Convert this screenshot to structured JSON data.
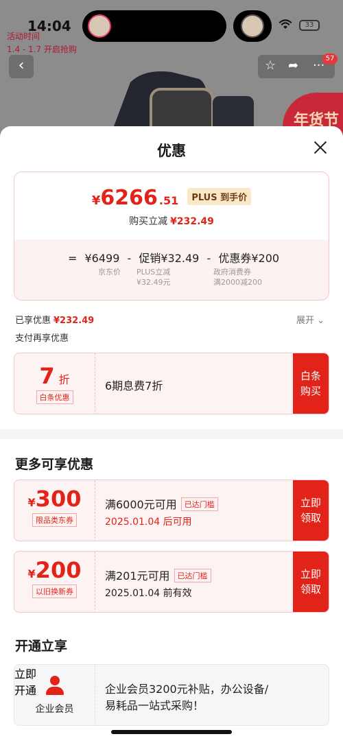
{
  "status": {
    "time": "14:04",
    "battery": "33"
  },
  "promo": {
    "line1": "活动时间",
    "line2": "1.4 - 1.7 开启抢购"
  },
  "nav": {
    "back": "‹",
    "star": "☆",
    "share": "➦",
    "more": "···",
    "cart_badge": "57"
  },
  "festival_label": "年货节",
  "sheet": {
    "title": "优惠",
    "price": {
      "yen": "¥",
      "integer": "6266",
      "decimal": ".51",
      "tag": "PLUS 到手价",
      "reduce_label": "购买立减",
      "reduce_value": "¥232.49"
    },
    "breakdown": {
      "row": [
        "=",
        "¥6499",
        "-",
        "促销¥32.49",
        "-",
        "优惠券¥200"
      ],
      "cap1": "京东价",
      "cap2_line1": "PLUS立减",
      "cap2_line2": "¥32.49元",
      "cap3_line1": "政府消费券",
      "cap3_line2": "满2000减200"
    },
    "enjoyed_label": "已享优惠",
    "enjoyed_value": "¥232.49",
    "expand_label": "展开 ⌄",
    "pay_title": "支付再享优惠",
    "baitiao": {
      "amount": "7",
      "unit": "折",
      "tag": "白条优惠",
      "desc": "6期息费7折",
      "button": "白条\n购买"
    },
    "more_title": "更多可享优惠",
    "coupons": [
      {
        "yen": "¥",
        "amount": "300",
        "tag": "限品类东券",
        "condition": "满6000元可用",
        "reach": "已达门槛",
        "date": "2025.01.04 后可用",
        "button": "立即\n领取"
      },
      {
        "yen": "¥",
        "amount": "200",
        "tag": "以旧换新券",
        "condition": "满201元可用",
        "reach": "已达门槛",
        "date": "2025.01.04 前有效",
        "button": "立即\n领取"
      }
    ],
    "open_title": "开通立享",
    "member": {
      "label": "企业会员",
      "desc": "企业会员3200元补贴，办公设备/易耗品一站式采购！",
      "button": "立即\n开通"
    }
  }
}
